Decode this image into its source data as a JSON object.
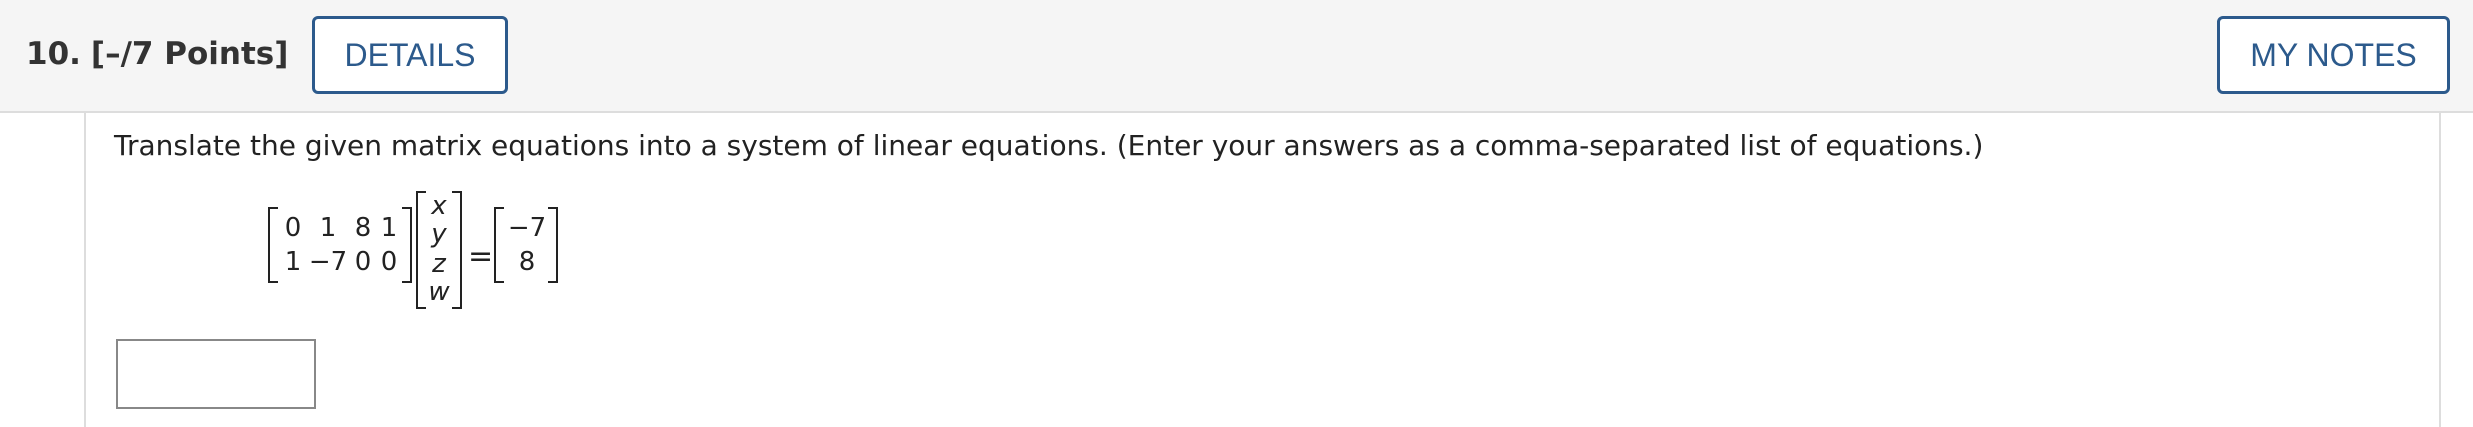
{
  "question": {
    "number": "10.",
    "points": "[–/7 Points]"
  },
  "buttons": {
    "details": "DETAILS",
    "my_notes": "MY NOTES"
  },
  "prompt": "Translate the given matrix equations into a system of linear equations. (Enter your answers as a comma-separated list of equations.)",
  "equation": {
    "coefficient_matrix": [
      [
        "0",
        "1",
        "8",
        "1"
      ],
      [
        "1",
        "−7",
        "0",
        "0"
      ]
    ],
    "variables": [
      "x",
      "y",
      "z",
      "w"
    ],
    "equals": "=",
    "constants": [
      "−7",
      "8"
    ]
  },
  "answer_input": {
    "value": ""
  }
}
